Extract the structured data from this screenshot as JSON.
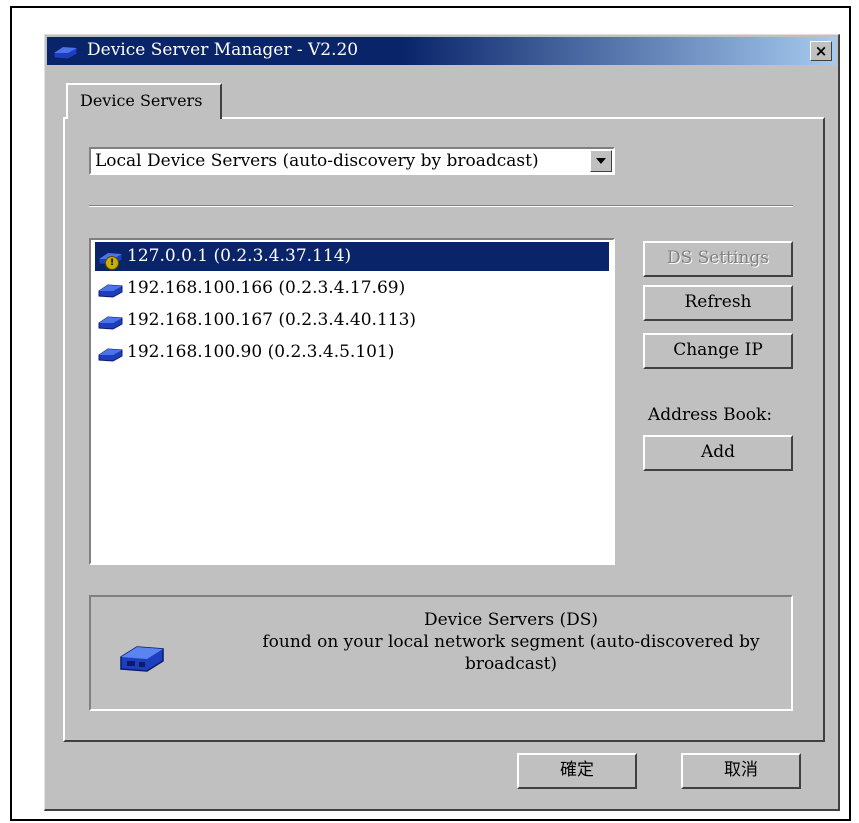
{
  "window": {
    "title": "Device Server Manager - V2.20",
    "close_glyph": "×",
    "colors": {
      "titlebar_start": "#0a246a",
      "titlebar_end": "#a6caf0",
      "face": "#c0c0c0",
      "selection": "#0a246a"
    }
  },
  "tabs": [
    {
      "label": "Device Servers",
      "selected": true
    }
  ],
  "source_select": {
    "selected": "Local Device Servers (auto-discovery by broadcast)"
  },
  "device_list": [
    {
      "label": "127.0.0.1 (0.2.3.4.37.114)",
      "icon": "device-server-warning-icon",
      "selected": true
    },
    {
      "label": "192.168.100.166 (0.2.3.4.17.69)",
      "icon": "device-server-icon",
      "selected": false
    },
    {
      "label": "192.168.100.167 (0.2.3.4.40.113)",
      "icon": "device-server-icon",
      "selected": false
    },
    {
      "label": "192.168.100.90 (0.2.3.4.5.101)",
      "icon": "device-server-icon",
      "selected": false
    }
  ],
  "side_buttons": {
    "ds_settings": "DS Settings",
    "refresh": "Refresh",
    "change_ip": "Change IP",
    "address_book_label": "Address Book:",
    "add": "Add"
  },
  "info": {
    "line1": "Device Servers (DS)",
    "line2": "found on your local network segment (auto-discovered by",
    "line3": "broadcast)"
  },
  "footer": {
    "ok": "確定",
    "cancel": "取消"
  }
}
